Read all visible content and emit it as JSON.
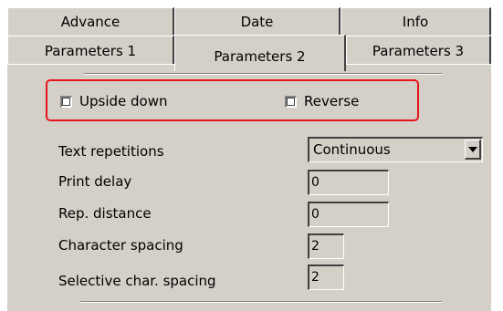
{
  "tabs": {
    "row1": [
      "Advance",
      "Date",
      "Info"
    ],
    "row2": [
      "Parameters 1",
      "Parameters 2",
      "Parameters 3"
    ],
    "active": "Parameters 2"
  },
  "options": {
    "upside_down": {
      "label": "Upside down",
      "checked": false
    },
    "reverse": {
      "label": "Reverse",
      "checked": false
    }
  },
  "fields": {
    "text_repetitions": {
      "label": "Text repetitions",
      "value": "Continuous"
    },
    "print_delay": {
      "label": "Print delay",
      "value": "0"
    },
    "rep_distance": {
      "label": "Rep. distance",
      "value": "0"
    },
    "character_spacing": {
      "label": "Character spacing",
      "value": "2"
    },
    "selective_char_spacing": {
      "label": "Selective char. spacing",
      "value": "2"
    }
  },
  "colors": {
    "panel": "#d4d0c8",
    "highlight": "#e8141c"
  }
}
